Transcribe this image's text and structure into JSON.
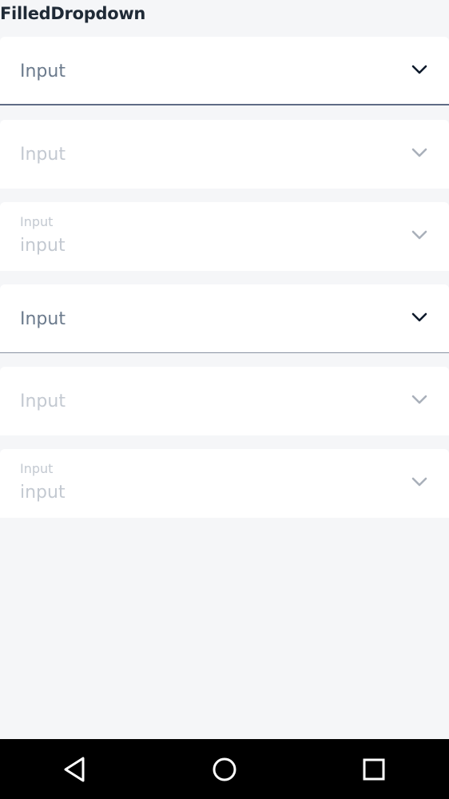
{
  "header": {
    "title": "FilledDropdown"
  },
  "dropdowns": [
    {
      "value": "Input",
      "state": "active"
    },
    {
      "value": "Input",
      "state": "disabled"
    },
    {
      "label": "Input",
      "value": "input",
      "state": "disabled"
    },
    {
      "value": "Input",
      "state": "bordered"
    },
    {
      "value": "Input",
      "state": "disabled"
    },
    {
      "label": "Input",
      "value": "input",
      "state": "disabled"
    }
  ],
  "icons": {
    "chevron_active_color": "#0d1a2b",
    "chevron_disabled_color": "#a9b0ba",
    "nav": [
      "back-icon",
      "home-icon",
      "recents-icon"
    ]
  },
  "colors": {
    "background": "#f5f6f8",
    "field": "#ffffff",
    "navbar": "#000000"
  }
}
